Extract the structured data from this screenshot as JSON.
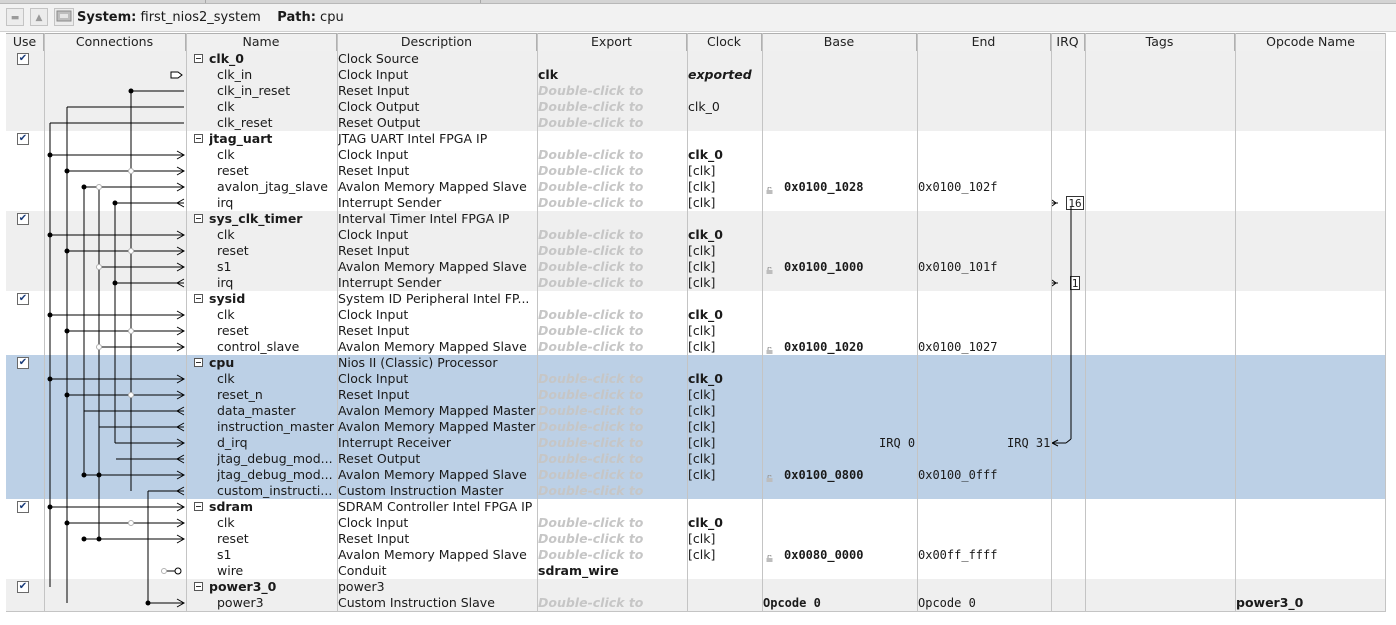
{
  "toolbar": {
    "system_label": "System:",
    "system_name": "first_nios2_system",
    "path_label": "Path:",
    "path_value": "cpu"
  },
  "columns": [
    "Use",
    "Connections",
    "Name",
    "Description",
    "Export",
    "Clock",
    "Base",
    "End",
    "IRQ",
    "Tags",
    "Opcode Name"
  ],
  "colors": {
    "selected_row": "#bcd0e6",
    "alt_row": "#efefef",
    "double_click_text": "#c6c6c6"
  },
  "components": [
    {
      "name": "clk_0",
      "description": "Clock Source",
      "checked": true,
      "rows": [
        {
          "name": "clk_in",
          "description": "Clock Input",
          "export": "clk",
          "export_style": "bold",
          "clock": "exported",
          "clock_style": "bolditalic"
        },
        {
          "name": "clk_in_reset",
          "description": "Reset Input",
          "export": "Double-click to"
        },
        {
          "name": "clk",
          "description": "Clock Output",
          "export": "Double-click to",
          "clock": "clk_0"
        },
        {
          "name": "clk_reset",
          "description": "Reset Output",
          "export": "Double-click to"
        }
      ]
    },
    {
      "name": "jtag_uart",
      "description": "JTAG UART Intel FPGA IP",
      "checked": true,
      "rows": [
        {
          "name": "clk",
          "description": "Clock Input",
          "export": "Double-click to",
          "clock": "clk_0",
          "clock_style": "bold"
        },
        {
          "name": "reset",
          "description": "Reset Input",
          "export": "Double-click to",
          "clock": "[clk]"
        },
        {
          "name": "avalon_jtag_slave",
          "description": "Avalon Memory Mapped Slave",
          "export": "Double-click to",
          "clock": "[clk]",
          "base": "0x0100_1028",
          "end": "0x0100_102f",
          "locked": true
        },
        {
          "name": "irq",
          "description": "Interrupt Sender",
          "export": "Double-click to",
          "clock": "[clk]",
          "irq": "16"
        }
      ]
    },
    {
      "name": "sys_clk_timer",
      "description": "Interval Timer Intel FPGA IP",
      "checked": true,
      "rows": [
        {
          "name": "clk",
          "description": "Clock Input",
          "export": "Double-click to",
          "clock": "clk_0",
          "clock_style": "bold"
        },
        {
          "name": "reset",
          "description": "Reset Input",
          "export": "Double-click to",
          "clock": "[clk]"
        },
        {
          "name": "s1",
          "description": "Avalon Memory Mapped Slave",
          "export": "Double-click to",
          "clock": "[clk]",
          "base": "0x0100_1000",
          "end": "0x0100_101f",
          "locked": true
        },
        {
          "name": "irq",
          "description": "Interrupt Sender",
          "export": "Double-click to",
          "clock": "[clk]",
          "irq": "1"
        }
      ]
    },
    {
      "name": "sysid",
      "description": "System ID Peripheral Intel FP...",
      "checked": true,
      "rows": [
        {
          "name": "clk",
          "description": "Clock Input",
          "export": "Double-click to",
          "clock": "clk_0",
          "clock_style": "bold"
        },
        {
          "name": "reset",
          "description": "Reset Input",
          "export": "Double-click to",
          "clock": "[clk]"
        },
        {
          "name": "control_slave",
          "description": "Avalon Memory Mapped Slave",
          "export": "Double-click to",
          "clock": "[clk]",
          "base": "0x0100_1020",
          "end": "0x0100_1027",
          "locked": true
        }
      ]
    },
    {
      "name": "cpu",
      "description": "Nios II (Classic) Processor",
      "checked": true,
      "selected": true,
      "rows": [
        {
          "name": "clk",
          "description": "Clock Input",
          "export": "Double-click to",
          "clock": "clk_0",
          "clock_style": "bold"
        },
        {
          "name": "reset_n",
          "description": "Reset Input",
          "export": "Double-click to",
          "clock": "[clk]"
        },
        {
          "name": "data_master",
          "description": "Avalon Memory Mapped Master",
          "export": "Double-click to",
          "clock": "[clk]"
        },
        {
          "name": "instruction_master",
          "description": "Avalon Memory Mapped Master",
          "export": "Double-click to",
          "clock": "[clk]"
        },
        {
          "name": "d_irq",
          "description": "Interrupt Receiver",
          "export": "Double-click to",
          "clock": "[clk]",
          "base": "IRQ 0",
          "end": "IRQ 31"
        },
        {
          "name": "jtag_debug_mod...",
          "description": "Reset Output",
          "export": "Double-click to",
          "clock": "[clk]"
        },
        {
          "name": "jtag_debug_mod...",
          "description": "Avalon Memory Mapped Slave",
          "export": "Double-click to",
          "clock": "[clk]",
          "base": "0x0100_0800",
          "end": "0x0100_0fff",
          "locked": true
        },
        {
          "name": "custom_instructi...",
          "description": "Custom Instruction Master",
          "export": "Double-click to"
        }
      ]
    },
    {
      "name": "sdram",
      "description": "SDRAM Controller Intel FPGA IP",
      "checked": true,
      "rows": [
        {
          "name": "clk",
          "description": "Clock Input",
          "export": "Double-click to",
          "clock": "clk_0",
          "clock_style": "bold"
        },
        {
          "name": "reset",
          "description": "Reset Input",
          "export": "Double-click to",
          "clock": "[clk]"
        },
        {
          "name": "s1",
          "description": "Avalon Memory Mapped Slave",
          "export": "Double-click to",
          "clock": "[clk]",
          "base": "0x0080_0000",
          "end": "0x00ff_ffff",
          "locked": true
        },
        {
          "name": "wire",
          "description": "Conduit",
          "export": "sdram_wire",
          "export_style": "bold"
        }
      ]
    },
    {
      "name": "power3_0",
      "description": "power3",
      "checked": true,
      "rows": [
        {
          "name": "power3",
          "description": "Custom Instruction Slave",
          "export": "Double-click to",
          "base": "Opcode 0",
          "end": "Opcode 0",
          "opcode": "power3_0"
        }
      ]
    }
  ]
}
